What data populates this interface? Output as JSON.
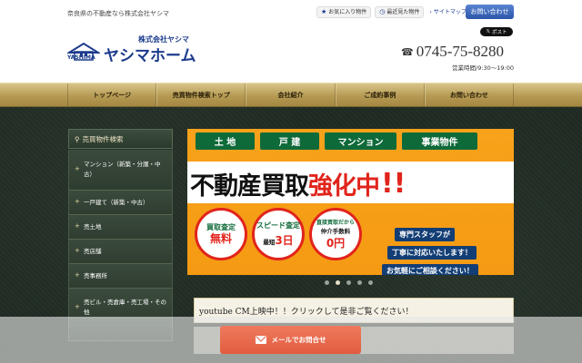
{
  "header": {
    "tagline": "奈良県の不動産なら株式会社ヤシマ",
    "logo_company": "株式会社ヤシマ",
    "logo_name": "ヤシマホーム",
    "logo_sub": "YASHIMA",
    "favorites": "お気に入り物件",
    "recent": "最近見た物件",
    "sitemap": "サイトマップ",
    "contact": "お問い合わせ",
    "x_post": "ポスト",
    "phone": "0745-75-8280",
    "hours": "営業時間/9:30～19:00"
  },
  "nav": {
    "items": [
      "トップページ",
      "売買物件検索トップ",
      "会社紹介",
      "ご成約事例",
      "お問い合わせ"
    ]
  },
  "sidebar": {
    "title": "売買物件検索",
    "items": [
      "マンション（新築・分譲・中古）",
      "一戸建て（新築・中古）",
      "売土地",
      "売店舗",
      "売事務所",
      "売ビル・売倉庫・売工場・その他"
    ]
  },
  "banner": {
    "tags": [
      "土 地",
      "戸 建",
      "マンション",
      "事業物件"
    ],
    "headline_black": "不動産買取",
    "headline_red": "強化中",
    "headline_exc": "!!",
    "circle1_top": "買取査定",
    "circle1_main": "無料",
    "circle2_top": "スピード査定",
    "circle2_sub": "最短",
    "circle2_num": "3日",
    "circle3_top": "直接買取だから",
    "circle3_sub": "仲介手数料",
    "circle3_main": "0円",
    "speech1": "専門スタッフが",
    "speech2": "丁寧に対応いたします！",
    "speech3": "お気軽にご相談ください！",
    "slide_count": 5,
    "active_slide": 2
  },
  "youtube": {
    "text": "youtube CM上映中！！クリックして是非ご覧ください！"
  },
  "bottom": {
    "mail_button": "メールでお問合せ"
  },
  "colors": {
    "brand_blue": "#1a3a8c",
    "nav_gold": "#b69a54",
    "banner_orange": "#f59a13",
    "accent_red": "#e1241c",
    "tag_green": "#0f6a3a",
    "mail_btn": "#e25c3f"
  }
}
